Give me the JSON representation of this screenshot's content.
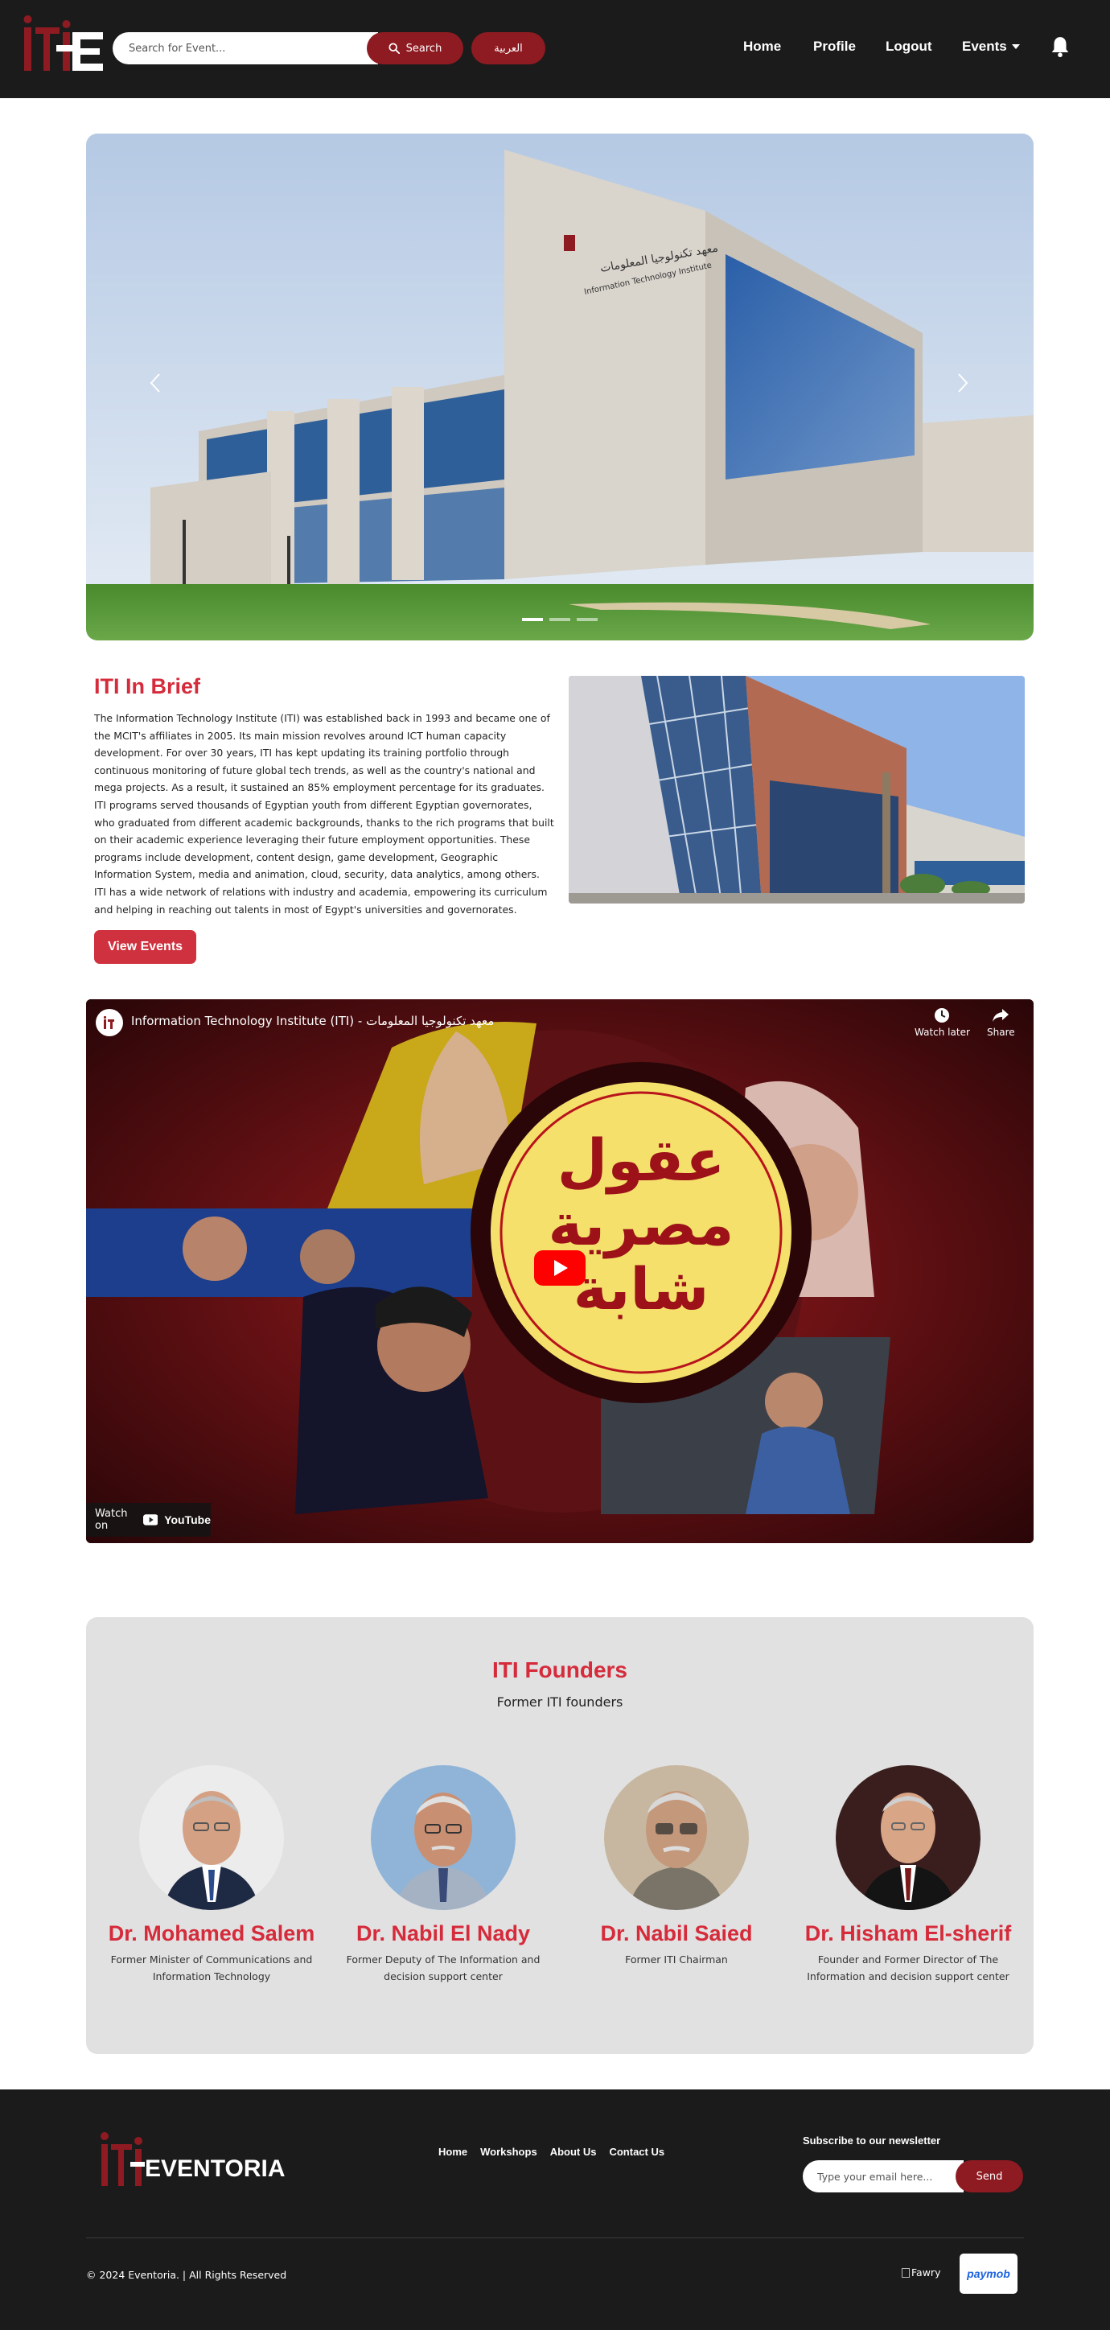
{
  "brand": {
    "name": "Eventoria",
    "accent": "#d52b3b",
    "dark_red": "#8f1b22",
    "navbar_bg": "#1b1b1b"
  },
  "navbar": {
    "search_placeholder": "Search for Event...",
    "search_label": "Search",
    "lang_label": "العربية",
    "links": {
      "home": "Home",
      "profile": "Profile",
      "logout": "Logout",
      "events": "Events"
    },
    "icons": [
      "search-icon",
      "bell-icon",
      "chevron-down-icon"
    ]
  },
  "hero": {
    "slides": 3,
    "active_slide": 1,
    "sign_arabic": "معهد تكنولوجيا المعلومات",
    "sign_english": "Information Technology Institute"
  },
  "brief": {
    "title": "ITI In Brief",
    "text": "The Information Technology Institute (ITI) was established back in 1993 and became one of the MCIT's affiliates in 2005. Its main mission revolves around ICT human capacity development. For over 30 years, ITI has kept updating its training portfolio through continuous monitoring of future global tech trends, as well as the country's national and mega projects. As a result, it sustained an 85% employment percentage for its graduates. ITI programs served thousands of Egyptian youth from different Egyptian governorates, who graduated from different academic backgrounds, thanks to the rich programs that built on their academic experience leveraging their future employment opportunities. These programs include development, content design, game development, Geographic Information System, media and animation, cloud, security, data analytics, among others. ITI has a wide network of relations with industry and academia, empowering its curriculum and helping in reaching out talents in most of Egypt's universities and governorates.",
    "button_label": "View Events"
  },
  "video": {
    "title": "Information Technology Institute (ITI) - معهد تكنولوجيا المعلومات",
    "watch_later": "Watch later",
    "share": "Share",
    "watch_on": "Watch on",
    "youtube": "YouTube",
    "thumbnail_text": [
      "عقول",
      "مصرية",
      "شابة"
    ]
  },
  "founders": {
    "title": "ITI Founders",
    "subtitle": "Former ITI founders",
    "items": [
      {
        "name": "Dr. Mohamed Salem",
        "role": "Former Minister of Communications and Information Technology"
      },
      {
        "name": "Dr. Nabil El Nady",
        "role": "Former Deputy of The Information and decision support center"
      },
      {
        "name": "Dr. Nabil Saied",
        "role": "Former ITI Chairman"
      },
      {
        "name": "Dr. Hisham El-sherif",
        "role": "Founder and Former Director of The Information and decision support center"
      }
    ]
  },
  "footer": {
    "logo_text": "EVENTORIA",
    "links": [
      "Home",
      "Workshops",
      "About Us",
      "Contact Us"
    ],
    "newsletter_title": "Subscribe to our newsletter",
    "newsletter_placeholder": "Type your email here...",
    "newsletter_button": "Send",
    "copyright": "© 2024 Eventoria. | All Rights Reserved",
    "payment_fawry": "Fawry",
    "payment_paymob": "paymob"
  }
}
